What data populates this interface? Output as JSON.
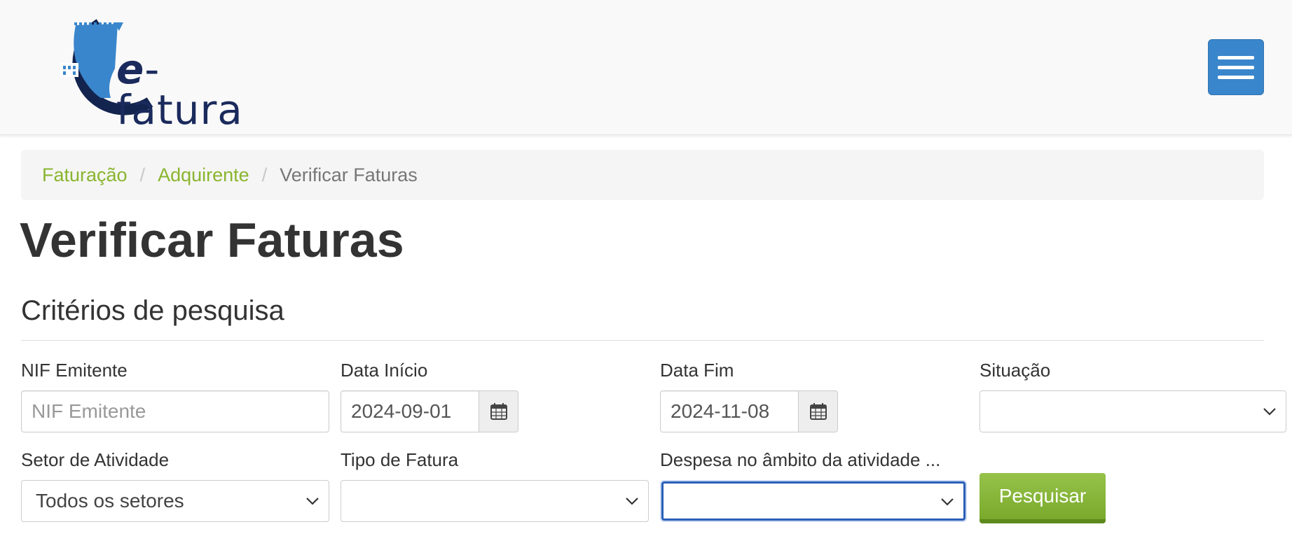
{
  "header": {
    "logo_text_e": "e",
    "logo_text_rest": "-fatura",
    "logo_icon": "efatura-logo",
    "menu_icon": "hamburger-menu-icon"
  },
  "breadcrumb": {
    "items": [
      "Faturação",
      "Adquirente"
    ],
    "current": "Verificar Faturas",
    "separator": "/"
  },
  "page": {
    "title": "Verificar Faturas",
    "section_title": "Critérios de pesquisa"
  },
  "form": {
    "nif": {
      "label": "NIF Emitente",
      "value": "",
      "placeholder": "NIF Emitente"
    },
    "data_inicio": {
      "label": "Data Início",
      "value": "2024-09-01",
      "icon": "calendar-icon"
    },
    "data_fim": {
      "label": "Data Fim",
      "value": "2024-11-08",
      "icon": "calendar-icon"
    },
    "situacao": {
      "label": "Situação",
      "value": ""
    },
    "setor": {
      "label": "Setor de Atividade",
      "value": "Todos os setores"
    },
    "tipo_fatura": {
      "label": "Tipo de Fatura",
      "value": ""
    },
    "despesa": {
      "label": "Despesa no âmbito da atividade ...",
      "value": ""
    },
    "search_button": "Pesquisar"
  },
  "colors": {
    "accent_green": "#8ab52f",
    "menu_blue": "#3a86cc",
    "button_green": "#7aaa2c",
    "logo_navy": "#1a2a5c"
  }
}
